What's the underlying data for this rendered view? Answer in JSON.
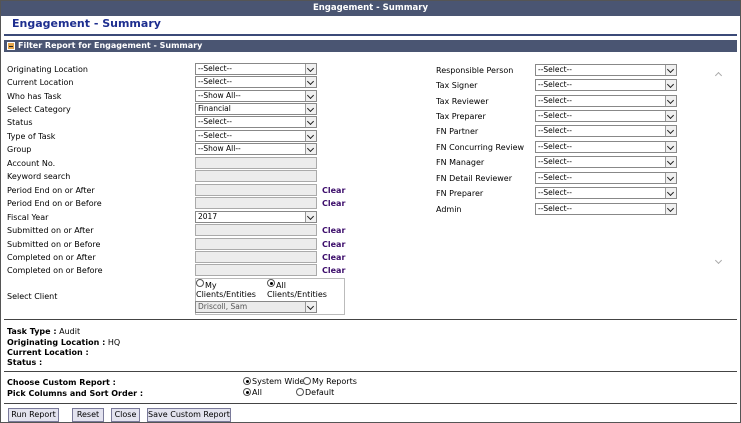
{
  "window": {
    "title": "Engagement - Summary"
  },
  "page": {
    "heading": "Engagement - Summary"
  },
  "filter_section": {
    "title": "Filter Report for Engagement - Summary"
  },
  "left_fields": {
    "originating_location": {
      "label": "Originating Location",
      "value": "--Select--"
    },
    "current_location": {
      "label": "Current Location",
      "value": "--Select--"
    },
    "who_has_task": {
      "label": "Who has Task",
      "value": "--Show All--"
    },
    "select_category": {
      "label": "Select Category",
      "value": "Financial"
    },
    "status": {
      "label": "Status",
      "value": "--Select--"
    },
    "type_of_task": {
      "label": "Type of Task",
      "value": "--Select--"
    },
    "group": {
      "label": "Group",
      "value": "--Show All--"
    },
    "account_no": {
      "label": "Account No."
    },
    "keyword_search": {
      "label": "Keyword search"
    },
    "period_end_after": {
      "label": "Period End on or After"
    },
    "period_end_before": {
      "label": "Period End on or Before"
    },
    "fiscal_year": {
      "label": "Fiscal Year",
      "value": "2017"
    },
    "submitted_after": {
      "label": "Submitted on or After"
    },
    "submitted_before": {
      "label": "Submitted on or Before"
    },
    "completed_after": {
      "label": "Completed on or After"
    },
    "completed_before": {
      "label": "Completed on or Before"
    },
    "select_client": {
      "label": "Select Client"
    }
  },
  "clear_label": "Clear",
  "client_filter": {
    "my_clients_line1": "My",
    "my_clients_line2": "Clients/Entities",
    "all_clients_line1": "All",
    "all_clients_line2": "Clients/Entities",
    "selected": "all",
    "client_value": "Driscoll, Sam"
  },
  "right_fields": {
    "responsible_person": {
      "label": "Responsible Person",
      "value": "--Select--"
    },
    "tax_signer": {
      "label": "Tax Signer",
      "value": "--Select--"
    },
    "tax_reviewer": {
      "label": "Tax Reviewer",
      "value": "--Select--"
    },
    "tax_preparer": {
      "label": "Tax Preparer",
      "value": "--Select--"
    },
    "fn_partner": {
      "label": "FN Partner",
      "value": "--Select--"
    },
    "fn_concurring_review": {
      "label": "FN Concurring Review",
      "value": "--Select--"
    },
    "fn_manager": {
      "label": "FN Manager",
      "value": "--Select--"
    },
    "fn_detail_reviewer": {
      "label": "FN Detail Reviewer",
      "value": "--Select--"
    },
    "fn_preparer": {
      "label": "FN Preparer",
      "value": "--Select--"
    },
    "admin": {
      "label": "Admin",
      "value": "--Select--"
    }
  },
  "summary": {
    "task_type_label": "Task Type :",
    "task_type_value": "Audit",
    "originating_location_label": "Originating Location :",
    "originating_location_value": "HQ",
    "current_location_label": "Current Location :",
    "status_label": "Status :"
  },
  "custom_report": {
    "label": "Choose Custom Report :",
    "option_system_wide": "System Wide",
    "option_my_reports": "My Reports",
    "selected": "system_wide"
  },
  "columns_sort": {
    "label": "Pick Columns and Sort Order :",
    "option_all": "All",
    "option_default": "Default",
    "selected": "all"
  },
  "buttons": {
    "run_report": "Run Report",
    "reset": "Reset",
    "close": "Close",
    "save_custom_report": "Save Custom Report"
  },
  "colors": {
    "header_bg": "#4a5572",
    "title_text": "#1d2e8f",
    "clear_link": "#3c0d6b"
  }
}
